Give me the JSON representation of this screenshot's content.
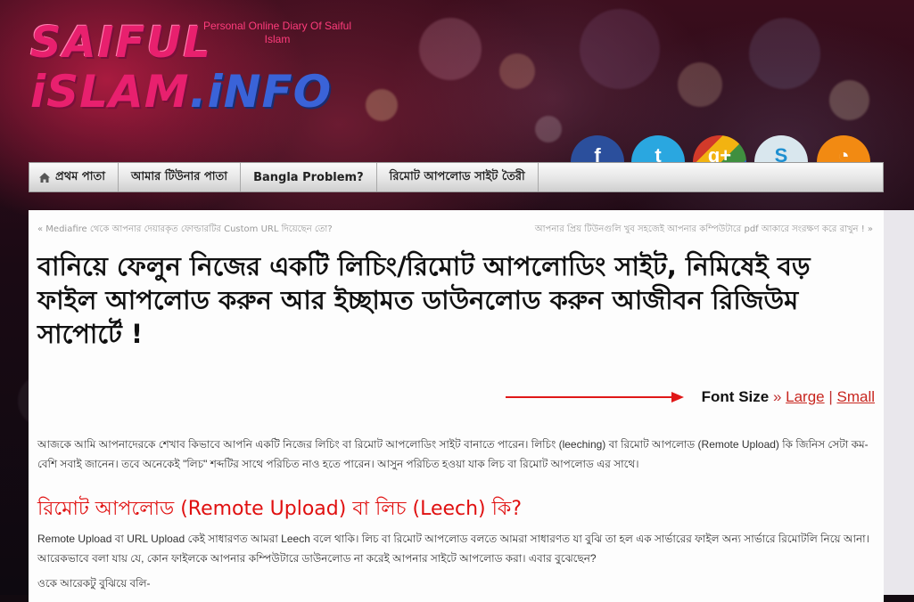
{
  "logo": {
    "line1": "SAIFUL",
    "line2a": "iSLAM",
    "line2b": ".iNFO",
    "tagline": "Personal Online Diary Of Saiful Islam"
  },
  "social": [
    {
      "icon": "facebook-icon",
      "glyph": "f",
      "color": "#2b4f9c"
    },
    {
      "icon": "twitter-icon",
      "glyph": "t",
      "color": "#2aa7e0"
    },
    {
      "icon": "google-plus-icon",
      "glyph": "g+",
      "color": "#3f8f3f"
    },
    {
      "icon": "skype-icon",
      "glyph": "S",
      "color": "#d9e7ee"
    },
    {
      "icon": "rss-icon",
      "glyph": "◔",
      "color": "#f28a12"
    }
  ],
  "nav": {
    "items": [
      "প্রথম পাতা",
      "আমার টিউনার পাতা",
      "Bangla Problem?",
      "রিমোট আপলোড সাইট তৈরী"
    ]
  },
  "post_nav": {
    "prev": "«  Mediafire থেকে আপনার দেয়ারকৃত ফোল্ডারটির Custom URL দিয়েছেন তো?",
    "next": "আপনার প্রিয় টিউনগুলি খুব সহজেই আপনার কম্পিউটারে pdf আকারে সংরক্ষণ করে রাখুন !  »"
  },
  "title": "বানিয়ে ফেলুন নিজের একটি লিচিং/রিমোট আপলোডিং সাইট, নিমিষেই বড় ফাইল আপলোড করুন আর ইচ্ছামত ডাউনলোড করুন আজীবন রিজিউম সাপোর্টে !",
  "font_size": {
    "label": "Font Size",
    "sep1": " » ",
    "large": "Large",
    "sep2": " | ",
    "small": "Small"
  },
  "colors": {
    "accent_red": "#e01010",
    "link_red": "#c8261f"
  },
  "paragraphs": {
    "intro": "আজকে আমি আপনাদেরকে শেখাব কিভাবে আপনি একটি নিজের লিচিং বা রিমোট আপলোডিং সাইট বানাতে পারেন। লিচিং (leeching) বা রিমোট আপলোড (Remote Upload) কি জিনিস সেটা কম-বেশি সবাই জানেন। তবে অনেকেই \"লিচ\" শব্দটির সাথে পরিচিত নাও হতে পারেন। আসুন পরিচিত হওয়া যাক লিচ বা রিমোট আপলোড এর সাথে।",
    "heading": "রিমোট আপলোড (Remote Upload) বা লিচ (Leech) কি?",
    "body": "Remote Upload বা URL Upload কেই সাধারণত আমরা Leech বলে থাকি। লিচ বা রিমোট আপলোড বলতে আমরা সাধারণত যা বুঝি তা হল এক সার্ভারের ফাইল অন্য সার্ভারে রিমোটলি নিয়ে আনা। আরেকভাবে বলা যায় যে, কোন ফাইলকে আপনার কম্পিউটারে ডাউনলোড না করেই আপনার সাইটে আপলোড করা। এবার বুঝেছেন?",
    "more": "ওকে আরেকটু বুঝিয়ে বলি-"
  }
}
